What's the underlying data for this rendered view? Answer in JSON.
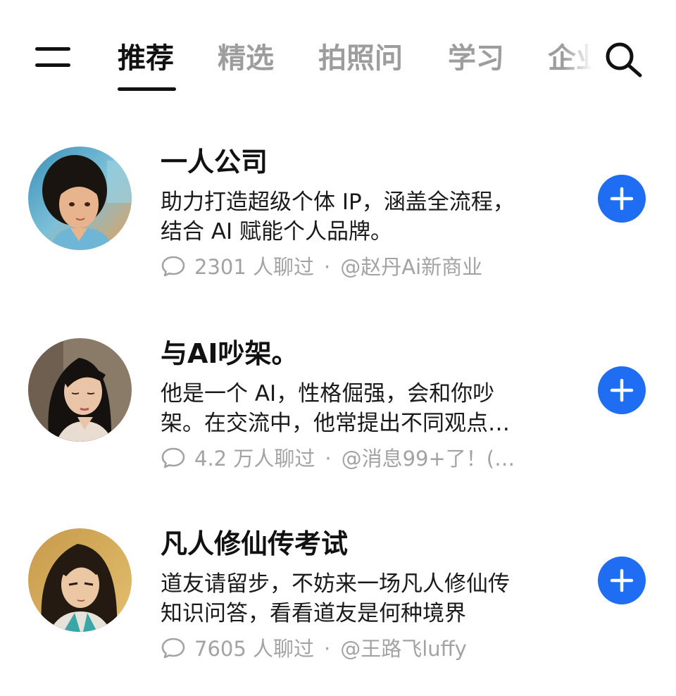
{
  "header": {
    "tabs": [
      {
        "label": "推荐",
        "active": true
      },
      {
        "label": "精选",
        "active": false
      },
      {
        "label": "拍照问",
        "active": false
      },
      {
        "label": "学习",
        "active": false
      },
      {
        "label": "企业",
        "active": false
      }
    ],
    "menu_icon": "menu-icon",
    "search_icon": "search-icon"
  },
  "bots": [
    {
      "name": "一人公司",
      "desc_line1": "助力打造超级个体 IP，涵盖全流程，",
      "desc_line2": "结合 AI 赋能个人品牌。",
      "chats": "2301 人聊过",
      "separator": "·",
      "author": "@赵丹Ai新商业"
    },
    {
      "name": "与AI吵架。",
      "desc_line1": "他是一个 AI，性格倔强，会和你吵",
      "desc_line2": "架。在交流中，他常提出不同观点…",
      "chats": "4.2 万人聊过",
      "separator": "·",
      "author": "@消息99+了！(…"
    },
    {
      "name": "凡人修仙传考试",
      "desc_line1": "道友请留步，不妨来一场凡人修仙传",
      "desc_line2": "知识问答，看看道友是何种境界",
      "chats": "7605 人聊过",
      "separator": "·",
      "author": "@王路飞luffy"
    }
  ],
  "colors": {
    "accent": "#1f6df2",
    "text_primary": "#111111",
    "text_muted": "#a3a3a3",
    "tab_inactive": "#9d9d9d"
  }
}
